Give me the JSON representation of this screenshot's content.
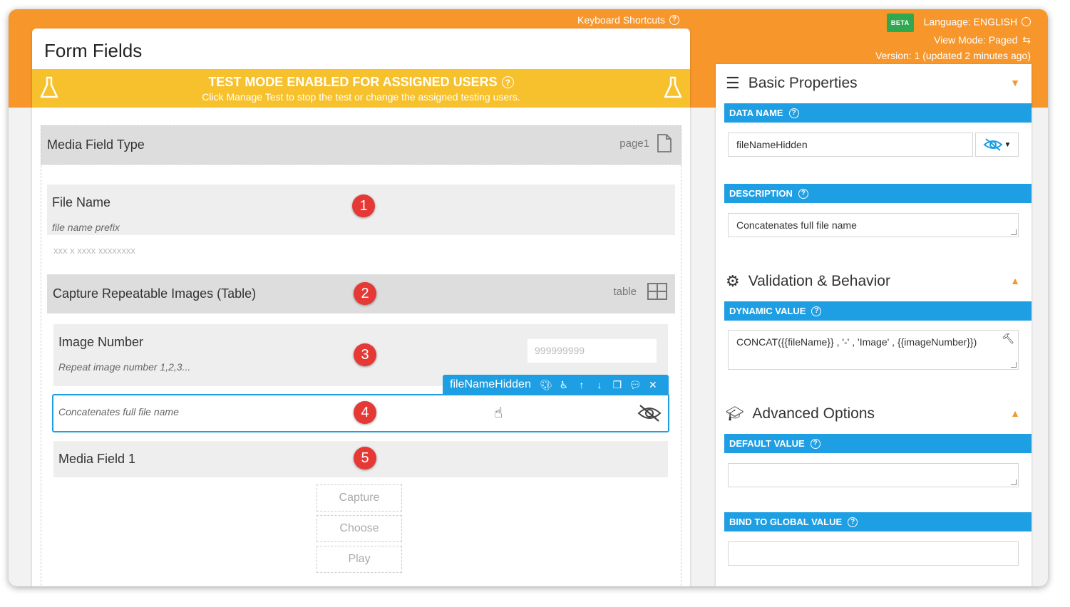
{
  "header": {
    "keyboard_shortcuts": "Keyboard Shortcuts",
    "beta": "BETA",
    "language": "Language: ENGLISH",
    "view_mode": "View Mode: Paged",
    "version": "Version: 1 (updated 2 minutes ago)"
  },
  "main": {
    "title": "Form Fields",
    "test_banner": {
      "title": "TEST MODE ENABLED FOR ASSIGNED USERS",
      "subtitle": "Click Manage Test to stop the test or change the assigned testing users."
    },
    "page_section": {
      "label": "Media Field Type",
      "page": "page1"
    },
    "fields": {
      "file_name": {
        "title": "File Name",
        "sub": "file name prefix",
        "placeholder": "xxx x xxxx xxxxxxxx",
        "badge": "1"
      },
      "table": {
        "title": "Capture Repeatable Images (Table)",
        "type": "table",
        "badge": "2"
      },
      "image_number": {
        "title": "Image Number",
        "sub": "Repeat image number 1,2,3...",
        "placeholder": "999999999",
        "badge": "3"
      },
      "hidden": {
        "sub": "Concatenates full file name",
        "badge": "4"
      },
      "media": {
        "title": "Media Field 1",
        "badge": "5"
      }
    },
    "toolbar": {
      "name": "fileNameHidden"
    },
    "media_buttons": {
      "capture": "Capture",
      "choose": "Choose",
      "play": "Play"
    }
  },
  "right_panel": {
    "basic": {
      "title": "Basic Properties",
      "data_name_label": "DATA NAME",
      "data_name_value": "fileNameHidden",
      "description_label": "DESCRIPTION",
      "description_value": "Concatenates full file name"
    },
    "validation": {
      "title": "Validation & Behavior",
      "dynamic_value_label": "DYNAMIC VALUE",
      "dynamic_value": "CONCAT({{fileName}} , '-' , 'Image' , {{imageNumber}})"
    },
    "advanced": {
      "title": "Advanced Options",
      "default_value_label": "DEFAULT VALUE",
      "default_value": "",
      "bind_global_label": "BIND TO GLOBAL VALUE",
      "bind_global_value": ""
    }
  },
  "colors": {
    "orange": "#f7962b",
    "yellow": "#f7c12e",
    "blue": "#1e9ee3",
    "red": "#e53935",
    "green": "#2fa84f"
  }
}
